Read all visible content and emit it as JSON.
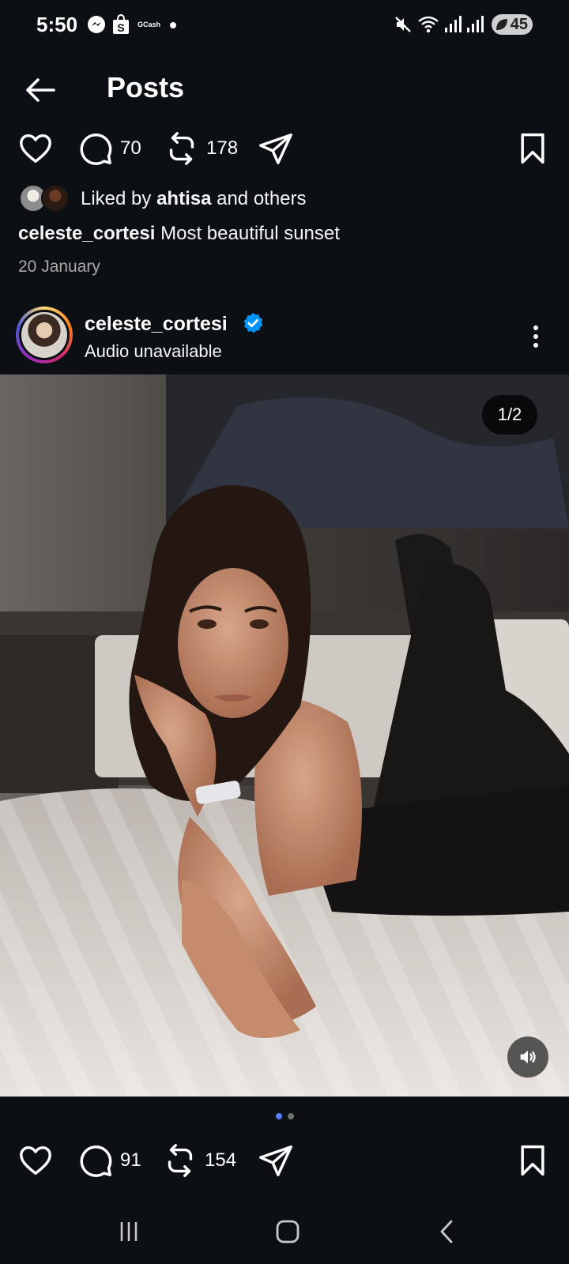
{
  "status_bar": {
    "time": "5:50",
    "gcash_label": "GCash",
    "battery": "45",
    "icons": [
      "messenger-icon",
      "shopee-icon",
      "gcash-icon",
      "mute-icon",
      "wifi-icon",
      "signal-icon",
      "signal-icon-2",
      "battery-icon"
    ]
  },
  "header": {
    "title": "Posts"
  },
  "previous_post": {
    "comments": "70",
    "reposts": "178",
    "liked_by_prefix": "Liked by ",
    "liked_by_user": "ahtisa",
    "liked_by_suffix": " and others",
    "caption_user": "celeste_cortesi",
    "caption_text": " Most beautiful sunset",
    "date": "20 January"
  },
  "post": {
    "username": "celeste_cortesi",
    "audio": "Audio unavailable",
    "counter": "1/2",
    "comments": "91",
    "reposts": "154"
  },
  "colors": {
    "background": "#0c1014",
    "verified": "#0095f6",
    "active_dot": "#5b7cff"
  }
}
